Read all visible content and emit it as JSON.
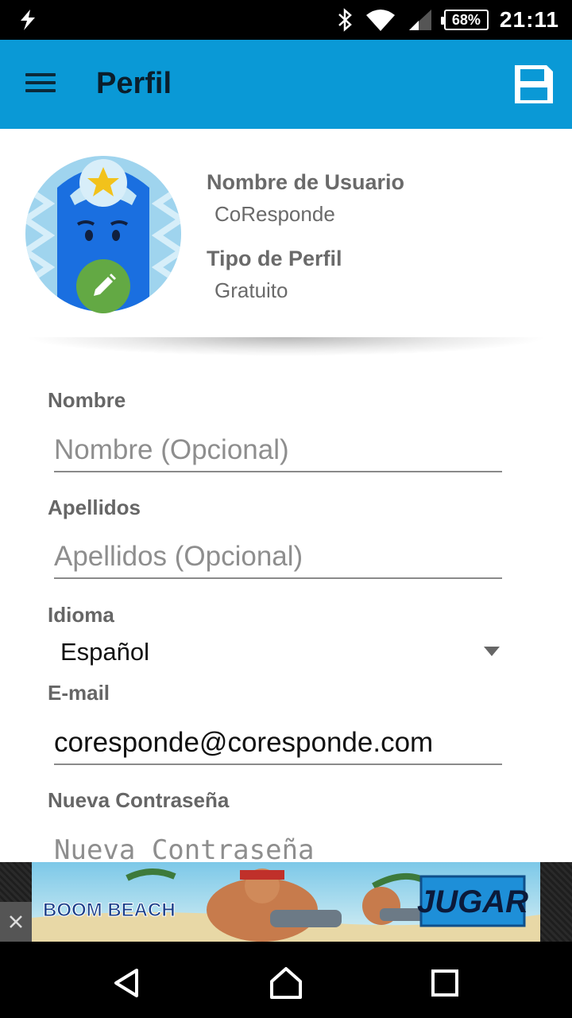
{
  "status_bar": {
    "battery": "68%",
    "time": "21:11"
  },
  "app_bar": {
    "title": "Perfil"
  },
  "profile": {
    "username_label": "Nombre de Usuario",
    "username": "CoResponde",
    "profile_type_label": "Tipo de Perfil",
    "profile_type": "Gratuito"
  },
  "form": {
    "nombre": {
      "label": "Nombre",
      "placeholder": "Nombre (Opcional)",
      "value": ""
    },
    "apellidos": {
      "label": "Apellidos",
      "placeholder": "Apellidos (Opcional)",
      "value": ""
    },
    "idioma": {
      "label": "Idioma",
      "selected": "Español"
    },
    "email": {
      "label": "E-mail",
      "value": "coresponde@coresponde.com"
    },
    "password": {
      "label": "Nueva Contraseña",
      "placeholder": "Nueva Contraseña"
    }
  },
  "ad": {
    "brand": "BOOM BEACH",
    "cta": "JUGAR"
  },
  "colors": {
    "app_bar": "#0a99d6",
    "edit_button": "#63a944",
    "avatar_bg": "#1a6fe0"
  },
  "icons": [
    "flash-icon",
    "bluetooth-icon",
    "wifi-icon",
    "signal-icon",
    "battery-icon",
    "menu-icon",
    "save-icon",
    "pencil-icon",
    "dropdown-arrow-icon",
    "close-icon",
    "back-icon",
    "home-icon",
    "recents-icon"
  ]
}
